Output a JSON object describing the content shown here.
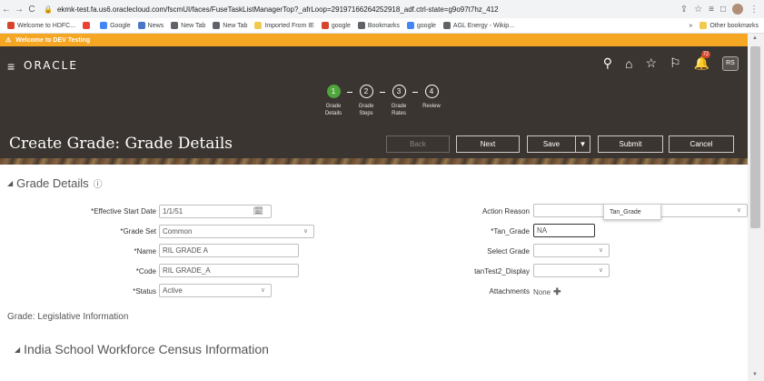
{
  "browser": {
    "back": "←",
    "forward": "→",
    "reload": "C",
    "url": "ekmk-test.fa.us6.oraclecloud.com/fscmUI/faces/FuseTaskListManagerTop?_afrLoop=29197166264252918_adf.ctrl-state=g9o97t7hz_412",
    "bookmarks": [
      {
        "label": "Welcome to HDFC...",
        "color": "#d6452c"
      },
      {
        "label": "M",
        "color": "#ffffff"
      },
      {
        "label": "Google",
        "color": "#4285f4"
      },
      {
        "label": "News",
        "color": "#4a76c8"
      },
      {
        "label": "New Tab",
        "color": "#5f6368"
      },
      {
        "label": "New Tab",
        "color": "#5f6368"
      },
      {
        "label": "Imported From IE",
        "color": "#f2c94c"
      },
      {
        "label": "google",
        "color": "#d6452c"
      },
      {
        "label": "Bookmarks",
        "color": "#5f6368"
      },
      {
        "label": "google",
        "color": "#4285f4"
      },
      {
        "label": "AGL Energy - Wikip...",
        "color": "#5f6368"
      }
    ],
    "more_bookmarks": "»",
    "other_bookmarks": "Other bookmarks"
  },
  "env_banner": "Welcome to DEV Testing",
  "header": {
    "logo": "ORACLE",
    "notification_count": "72",
    "avatar": "RS",
    "page_title": "Create Grade: Grade Details"
  },
  "train": [
    {
      "number": "1",
      "label": "Grade Details",
      "active": true
    },
    {
      "number": "2",
      "label": "Grade Steps",
      "active": false
    },
    {
      "number": "3",
      "label": "Grade Rates",
      "active": false
    },
    {
      "number": "4",
      "label": "Review",
      "active": false
    }
  ],
  "buttons": {
    "back": "Back",
    "next": "Next",
    "save": "Save",
    "save_menu": "▼",
    "submit": "Submit",
    "cancel": "Cancel"
  },
  "section": {
    "title": "Grade Details"
  },
  "left_fields": {
    "effective_start_date": {
      "label": "Effective Start Date",
      "value": "1/1/51"
    },
    "grade_set": {
      "label": "Grade Set",
      "value": "Common"
    },
    "name": {
      "label": "Name",
      "value": "RIL GRADE A"
    },
    "code": {
      "label": "Code",
      "value": "RIL GRADE_A"
    },
    "status": {
      "label": "Status",
      "value": "Active"
    }
  },
  "right_fields": {
    "action_reason": {
      "label": "Action Reason",
      "value": ""
    },
    "tan_grade": {
      "label": "Tan_Grade",
      "value": "NA"
    },
    "select_grade": {
      "label": "Select Grade",
      "value": ""
    },
    "tantest2_display": {
      "label": "tanTest2_Display",
      "value": ""
    },
    "attachments": {
      "label": "Attachments",
      "value": "None"
    }
  },
  "tooltip": "Tan_Grade",
  "legislative_info": "Grade: Legislative Information",
  "census_section": "India School Workforce Census Information"
}
